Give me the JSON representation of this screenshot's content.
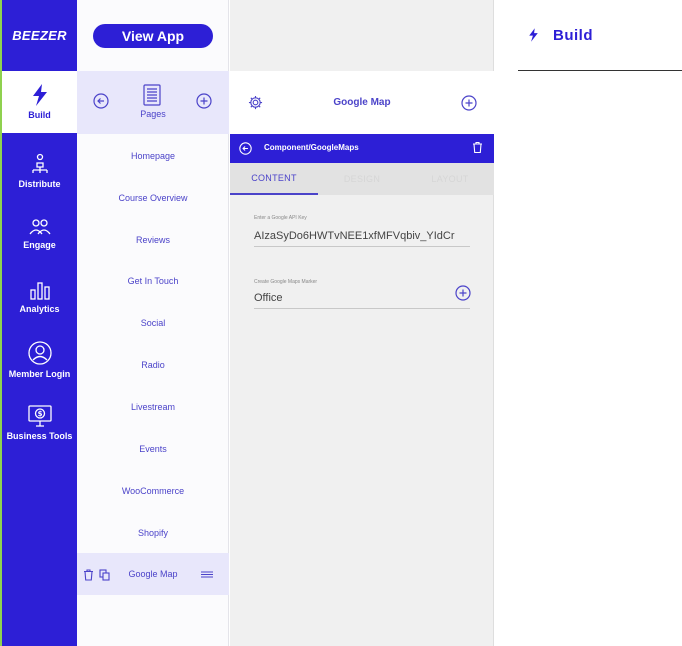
{
  "brand": {
    "logo_text": "BEEZER",
    "accent": "#2d1fd6",
    "highlight": "#8fd14f"
  },
  "nav": {
    "items": [
      {
        "label": "Build",
        "icon": "bolt-icon",
        "active": true
      },
      {
        "label": "Distribute",
        "icon": "distribute-icon"
      },
      {
        "label": "Engage",
        "icon": "users-icon"
      },
      {
        "label": "Analytics",
        "icon": "bar-chart-icon"
      },
      {
        "label": "Member Login",
        "icon": "user-circle-icon"
      },
      {
        "label": "Business Tools",
        "icon": "monitor-dollar-icon"
      }
    ]
  },
  "pages_panel": {
    "view_app_label": "View App",
    "header_label": "Pages",
    "items": [
      {
        "label": "Homepage"
      },
      {
        "label": "Course Overview"
      },
      {
        "label": "Reviews"
      },
      {
        "label": "Get In Touch"
      },
      {
        "label": "Social"
      },
      {
        "label": "Radio"
      },
      {
        "label": "Livestream"
      },
      {
        "label": "Events"
      },
      {
        "label": "WooCommerce"
      },
      {
        "label": "Shopify"
      },
      {
        "label": "Google Map",
        "selected": true
      }
    ]
  },
  "editor": {
    "title": "Google Map",
    "component_path": "Component/GoogleMaps",
    "tabs": [
      {
        "label": "CONTENT",
        "active": true
      },
      {
        "label": "DESIGN"
      },
      {
        "label": "LAYOUT"
      }
    ],
    "api_key": {
      "label": "Enter a Google API Key",
      "value": "AIzaSyDo6HWTvNEE1xfMFVqbiv_YIdCr"
    },
    "marker": {
      "label": "Create Google Maps Marker",
      "value": "Office"
    }
  },
  "preview": {
    "title": "Build"
  }
}
